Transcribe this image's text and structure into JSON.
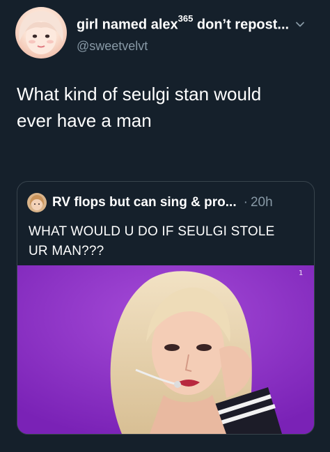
{
  "tweet": {
    "author": {
      "display_name": "girl named alex",
      "superscript": "365",
      "name_suffix": " don’t repost...",
      "handle": "@sweetvelvt",
      "avatar_icon": "profile-photo",
      "menu_icon": "chevron-down-icon"
    },
    "text_line1": "What kind of seulgi stan would",
    "text_line2": "ever have a man"
  },
  "quoted_tweet": {
    "author_name": "RV flops but can sing & pro...",
    "separator": "·",
    "time": "20h",
    "text_line1": "WHAT WOULD U DO IF SEULGI STOLE",
    "text_line2": "UR MAN???",
    "media_icon": "photo-of-performer"
  },
  "colors": {
    "background": "#15202b",
    "text": "#ffffff",
    "secondary_text": "#8899a6",
    "border": "#38444d",
    "media_background": "#8f2fc9"
  }
}
